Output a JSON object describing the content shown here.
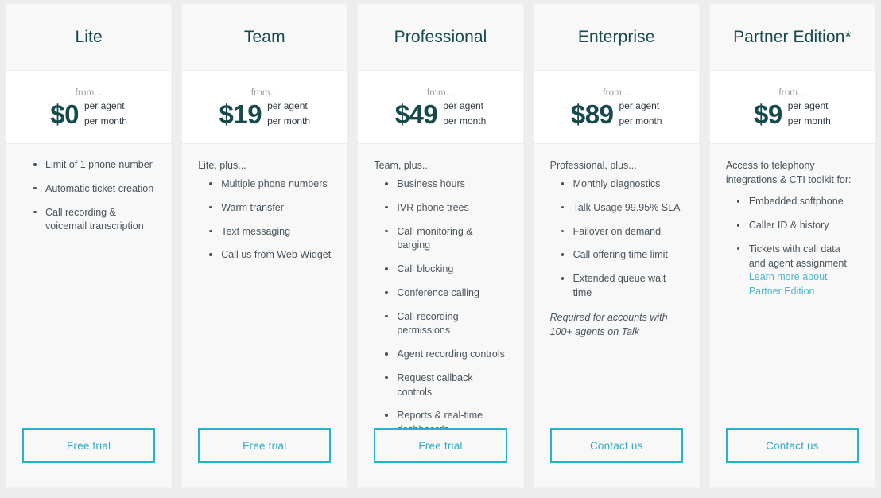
{
  "page": {
    "background_color": "#ededed",
    "accent_color": "#29b0cc",
    "title_color": "#17494d",
    "link_color": "#4eb6c9",
    "text_color": "#49545c"
  },
  "plans": [
    {
      "name": "Lite",
      "from_label": "from...",
      "price": "$0",
      "unit_line1": "per agent",
      "unit_line2": "per month",
      "intro": "",
      "features": [
        "Limit of 1 phone number",
        "Automatic ticket creation",
        "Call recording & voicemail transcription"
      ],
      "link": "",
      "note": "",
      "cta": "Free trial"
    },
    {
      "name": "Team",
      "from_label": "from...",
      "price": "$19",
      "unit_line1": "per agent",
      "unit_line2": "per month",
      "intro": "Lite, plus...",
      "features": [
        "Multiple phone numbers",
        "Warm transfer",
        "Text messaging",
        "Call us from Web Widget"
      ],
      "link": "",
      "note": "",
      "cta": "Free trial"
    },
    {
      "name": "Professional",
      "from_label": "from...",
      "price": "$49",
      "unit_line1": "per agent",
      "unit_line2": "per month",
      "intro": "Team, plus...",
      "features": [
        "Business hours",
        "IVR phone trees",
        "Call monitoring & barging",
        "Call blocking",
        "Conference calling",
        "Call recording permissions",
        "Agent recording controls",
        "Request callback controls",
        "Reports & real-time dashboards"
      ],
      "link": "",
      "note": "",
      "cta": "Free trial"
    },
    {
      "name": "Enterprise",
      "from_label": "from...",
      "price": "$89",
      "unit_line1": "per agent",
      "unit_line2": "per month",
      "intro": "Professional, plus...",
      "features": [
        "Monthly diagnostics",
        "Talk Usage 99.95% SLA",
        "Failover on demand",
        "Call offering time limit",
        "Extended queue wait time"
      ],
      "link": "",
      "note": "Required for accounts with 100+ agents on Talk",
      "cta": "Contact us"
    },
    {
      "name": "Partner Edition*",
      "from_label": "from...",
      "price": "$9",
      "unit_line1": "per agent",
      "unit_line2": "per month",
      "intro": "Access to telephony integrations & CTI toolkit for:",
      "features": [
        "Embedded softphone",
        "Caller ID & history",
        "Tickets with call data and agent assignment"
      ],
      "link": "Learn more about Partner Edition",
      "note": "",
      "cta": "Contact us"
    }
  ]
}
